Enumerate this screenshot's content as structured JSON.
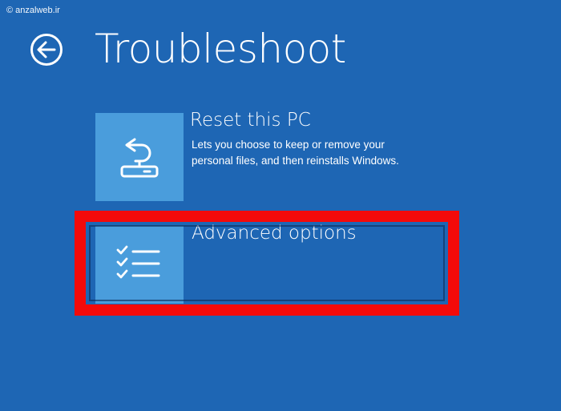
{
  "watermark": "© anzalweb.ir",
  "page": {
    "title": "Troubleshoot",
    "back_icon": "back-arrow-circle-icon"
  },
  "options": [
    {
      "title": "Reset this PC",
      "description": "Lets you choose to keep or remove your personal files, and then reinstalls Windows.",
      "icon": "reset-pc-icon"
    },
    {
      "title": "Advanced options",
      "description": "",
      "icon": "checklist-icon"
    }
  ],
  "colors": {
    "background": "#1e66b4",
    "tile": "#4a9ddc",
    "highlight": "#f40a0a",
    "text": "#ffffff"
  }
}
